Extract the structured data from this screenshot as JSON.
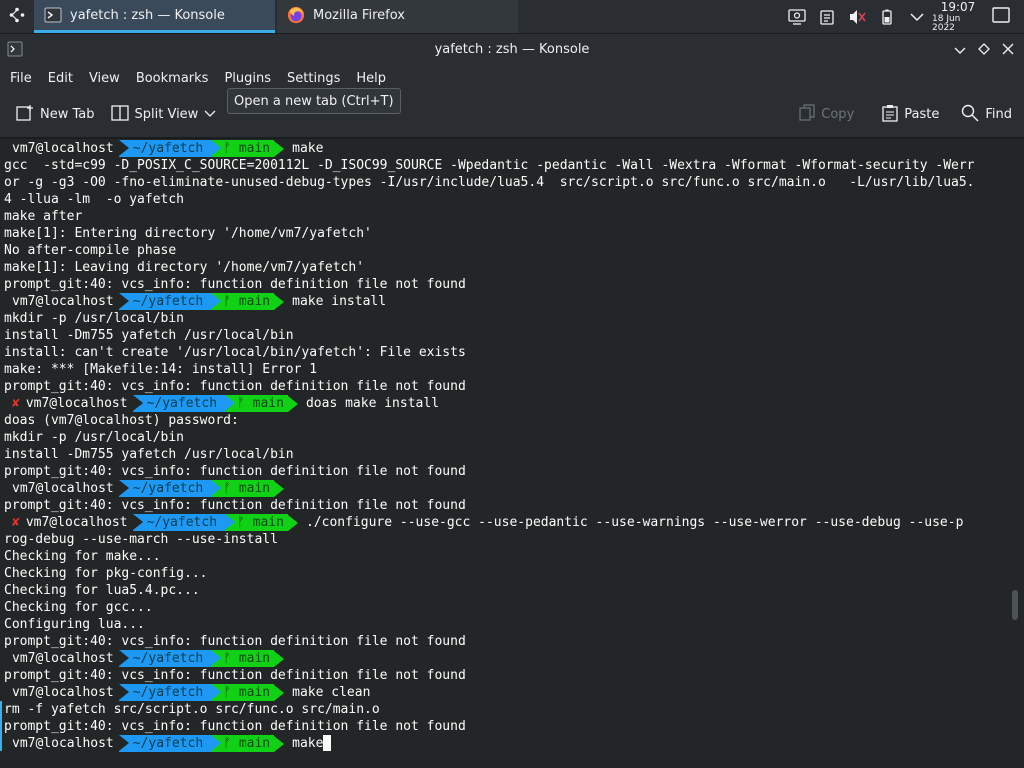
{
  "panel": {
    "tasks": [
      {
        "label": "yafetch : zsh — Konsole",
        "icon": "konsole-icon"
      },
      {
        "label": "Mozilla Firefox",
        "icon": "firefox-icon"
      }
    ],
    "clock": {
      "time": "19:07",
      "date": "18 Jun 2022"
    }
  },
  "window": {
    "title": "yafetch : zsh — Konsole"
  },
  "menubar": {
    "items": [
      "File",
      "Edit",
      "View",
      "Bookmarks",
      "Plugins",
      "Settings",
      "Help"
    ]
  },
  "toolbar": {
    "new_tab": "New Tab",
    "split_view": "Split View",
    "copy": "Copy",
    "paste": "Paste",
    "find": "Find",
    "tooltip": "Open a new tab (Ctrl+T)"
  },
  "prompt": {
    "user": "vm7@localhost",
    "path": "~/yafetch",
    "branch": "ᚠ main",
    "error_mark": "✘"
  },
  "colors": {
    "accent": "#3daee9",
    "path_bg": "#1d99f3",
    "branch_bg": "#11d116",
    "error": "#e0322e"
  },
  "terminal": {
    "lines": [
      {
        "type": "prompt",
        "cmd": "make"
      },
      {
        "type": "text",
        "text": "gcc  -std=c99 -D_POSIX_C_SOURCE=200112L -D_ISOC99_SOURCE -Wpedantic -pedantic -Wall -Wextra -Wformat -Wformat-security -Werr"
      },
      {
        "type": "text",
        "text": "or -g -g3 -O0 -fno-eliminate-unused-debug-types -I/usr/include/lua5.4  src/script.o src/func.o src/main.o   -L/usr/lib/lua5."
      },
      {
        "type": "text",
        "text": "4 -llua -lm  -o yafetch"
      },
      {
        "type": "text",
        "text": "make after"
      },
      {
        "type": "text",
        "text": "make[1]: Entering directory '/home/vm7/yafetch'"
      },
      {
        "type": "text",
        "text": "No after-compile phase"
      },
      {
        "type": "text",
        "text": "make[1]: Leaving directory '/home/vm7/yafetch'"
      },
      {
        "type": "text",
        "text": "prompt_git:40: vcs_info: function definition file not found"
      },
      {
        "type": "prompt",
        "cmd": "make install"
      },
      {
        "type": "text",
        "text": "mkdir -p /usr/local/bin"
      },
      {
        "type": "text",
        "text": "install -Dm755 yafetch /usr/local/bin"
      },
      {
        "type": "text",
        "text": "install: can't create '/usr/local/bin/yafetch': File exists"
      },
      {
        "type": "text",
        "text": "make: *** [Makefile:14: install] Error 1"
      },
      {
        "type": "text",
        "text": "prompt_git:40: vcs_info: function definition file not found"
      },
      {
        "type": "prompt_err",
        "cmd": "doas make install"
      },
      {
        "type": "text",
        "text": "doas (vm7@localhost) password:"
      },
      {
        "type": "text",
        "text": "mkdir -p /usr/local/bin"
      },
      {
        "type": "text",
        "text": "install -Dm755 yafetch /usr/local/bin"
      },
      {
        "type": "text",
        "text": "prompt_git:40: vcs_info: function definition file not found"
      },
      {
        "type": "prompt",
        "cmd": ""
      },
      {
        "type": "text",
        "text": "prompt_git:40: vcs_info: function definition file not found"
      },
      {
        "type": "prompt_err",
        "cmd": "./configure --use-gcc --use-pedantic --use-warnings --use-werror --use-debug --use-p"
      },
      {
        "type": "text",
        "text": "rog-debug --use-march --use-install"
      },
      {
        "type": "text",
        "text": "Checking for make..."
      },
      {
        "type": "text",
        "text": "Checking for pkg-config..."
      },
      {
        "type": "text",
        "text": "Checking for lua5.4.pc..."
      },
      {
        "type": "text",
        "text": "Checking for gcc..."
      },
      {
        "type": "text",
        "text": "Configuring lua..."
      },
      {
        "type": "text",
        "text": "prompt_git:40: vcs_info: function definition file not found"
      },
      {
        "type": "prompt",
        "cmd": ""
      },
      {
        "type": "text",
        "text": "prompt_git:40: vcs_info: function definition file not found"
      },
      {
        "type": "prompt",
        "cmd": "make clean"
      },
      {
        "type": "text",
        "text": "rm -f yafetch src/script.o src/func.o src/main.o"
      },
      {
        "type": "text",
        "text": "prompt_git:40: vcs_info: function definition file not found"
      },
      {
        "type": "prompt_cursor",
        "cmd": "make"
      }
    ]
  }
}
